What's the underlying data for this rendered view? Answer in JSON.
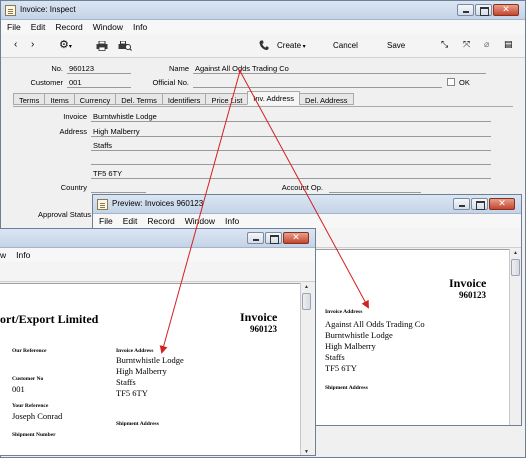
{
  "inspect": {
    "title": "Invoice: Inspect",
    "menu": [
      "File",
      "Edit",
      "Record",
      "Window",
      "Info"
    ],
    "toolbar": {
      "create": "Create",
      "cancel": "Cancel",
      "save": "Save"
    },
    "fields": {
      "no_label": "No.",
      "no_value": "960123",
      "name_label": "Name",
      "name_value": "Against All Odds Trading Co",
      "customer_label": "Customer",
      "customer_value": "001",
      "official_label": "Official No.",
      "ok_label": "OK"
    },
    "tabs": [
      "Terms",
      "Items",
      "Currency",
      "Del. Terms",
      "Identifiers",
      "Price List",
      "Inv. Address",
      "Del. Address"
    ],
    "address": {
      "invoice_label": "Invoice",
      "invoice_value": "Burntwhistle Lodge",
      "address_label": "Address",
      "lines": [
        "High Malberry",
        "Staffs",
        "",
        "TF5 6TY"
      ],
      "country_label": "Country",
      "account_label": "Account Op.",
      "approval_label": "Approval Status"
    }
  },
  "preview_right": {
    "title": "Preview: Invoices 960123",
    "menu": [
      "File",
      "Edit",
      "Record",
      "Window",
      "Info"
    ],
    "doc_title": "Invoice",
    "doc_number": "960123",
    "invoice_address_label": "Invoice Address",
    "invoice_address": [
      "Against All Odds Trading Co",
      "Burntwhistle Lodge",
      "High Malberry",
      "Staffs",
      "TF5 6TY"
    ],
    "shipment_label": "Shipment Address"
  },
  "preview_left": {
    "menu": [
      "w",
      "Info"
    ],
    "company": "ort/Export Limited",
    "doc_title": "Invoice",
    "doc_number": "960123",
    "our_ref_label": "Our Reference",
    "customer_no_label": "Customer No",
    "customer_no": "001",
    "your_ref_label": "Your Reference",
    "your_ref": "Joseph Conrad",
    "shipment_no_label": "Shipment Number",
    "invoice_address_label": "Invoice Address",
    "invoice_address": [
      "Burntwhistle Lodge",
      "High Malberry",
      "Staffs",
      "TF5 6TY"
    ],
    "shipment_label": "Shipment Address"
  },
  "colors": {
    "arrow": "#d42020",
    "titlebar": "#c8d7ea",
    "close": "#c4452f"
  },
  "icons": [
    "back-icon",
    "forward-icon",
    "gear-icon",
    "print-icon",
    "print-preview-icon",
    "phone-icon",
    "minimize-icon",
    "expand-icon",
    "attach-icon",
    "contacts-icon"
  ]
}
